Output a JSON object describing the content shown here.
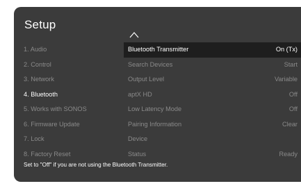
{
  "title": "Setup",
  "menu": {
    "items": [
      {
        "label": "1. Audio"
      },
      {
        "label": "2. Control"
      },
      {
        "label": "3. Network"
      },
      {
        "label": "4. Bluetooth"
      },
      {
        "label": "5. Works with SONOS"
      },
      {
        "label": "6. Firmware Update"
      },
      {
        "label": "7. Lock"
      },
      {
        "label": "8. Factory Reset"
      }
    ],
    "active_index": 3
  },
  "scroll_up_icon": "chevron-up-icon",
  "settings": {
    "rows": [
      {
        "name": "Bluetooth Transmitter",
        "value": "On (Tx)"
      },
      {
        "name": "Search Devices",
        "value": "Start"
      },
      {
        "name": "Output Level",
        "value": "Variable"
      },
      {
        "name": "aptX HD",
        "value": "Off"
      },
      {
        "name": "Low Latency Mode",
        "value": "Off"
      },
      {
        "name": "Pairing Information",
        "value": "Clear"
      },
      {
        "name": "Device",
        "value": ""
      },
      {
        "name": "Status",
        "value": "Ready"
      }
    ],
    "selected_index": 0
  },
  "hint": "Set to \"Off\" if you are not using the Bluetooth Transmitter.",
  "colors": {
    "panel_background": "#3b3b3b",
    "selected_row_background": "#1e1e1e",
    "active_text": "#ffffff",
    "inactive_text": "#8a8a8a"
  }
}
